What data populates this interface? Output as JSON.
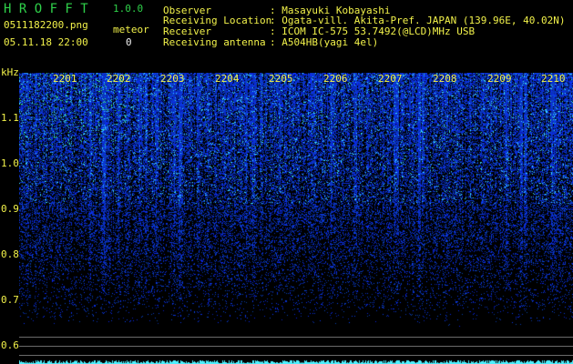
{
  "header": {
    "app_name": "H R O F F T",
    "version": "1.0.0",
    "filename": "0511182200.png",
    "meteor_label": "meteor",
    "datetime": "05.11.18 22:00",
    "meteor_count": "0"
  },
  "info": [
    {
      "label": "Observer",
      "value": ": Masayuki Kobayashi"
    },
    {
      "label": "Receiving Location",
      "value": ": Ogata-vill. Akita-Pref. JAPAN (139.96E, 40.02N)"
    },
    {
      "label": "Receiver",
      "value": ": ICOM IC-575 53.7492(@LCD)MHz USB"
    },
    {
      "label": "Receiving antenna",
      "value": ": A504HB(yagi 4el)"
    }
  ],
  "axis": {
    "y_unit": "kHz",
    "y_ticks": [
      "1.1",
      "1.0",
      "0.9",
      "0.8",
      "0.7",
      "0.6"
    ],
    "x_ticks": [
      "2201",
      "2202",
      "2203",
      "2204",
      "2205",
      "2206",
      "2207",
      "2208",
      "2209",
      "2210"
    ]
  },
  "colors": {
    "background": "#000000",
    "header_green": "#2fd14a",
    "header_yellow": "#f2f24a",
    "signal_blue": "#1a2cff",
    "signal_cyan": "#4ff0ff",
    "signal_green": "#3cff7a",
    "reference_line": "#6a6a6a"
  }
}
